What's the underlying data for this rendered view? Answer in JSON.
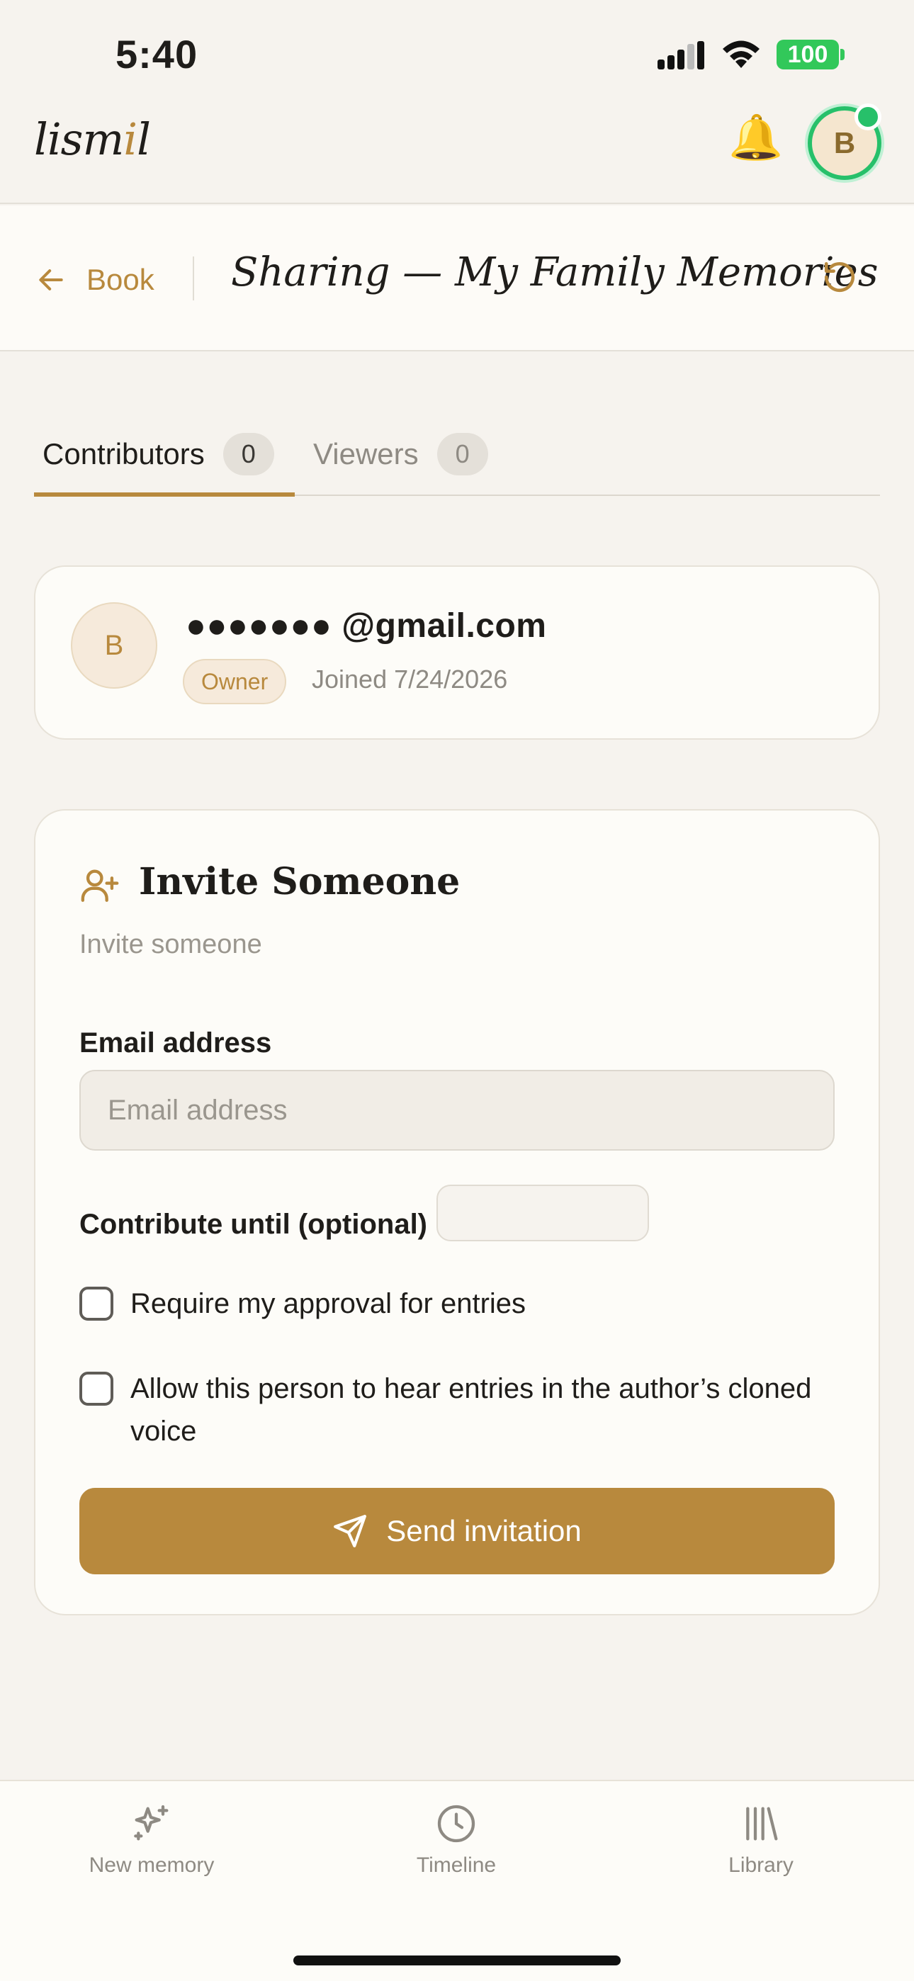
{
  "status_bar": {
    "time": "5:40",
    "battery": "100"
  },
  "header": {
    "logo_prefix": "lism",
    "logo_accent": "i",
    "logo_suffix": "l",
    "notification_icon": "bell-icon",
    "avatar_initial": "B"
  },
  "title_bar": {
    "back_label": "Book",
    "title": "Sharing — My Family Memories"
  },
  "tabs": [
    {
      "label": "Contributors",
      "count": "0",
      "active": true
    },
    {
      "label": "Viewers",
      "count": "0",
      "active": false
    }
  ],
  "owner": {
    "initial": "B",
    "email": "●●●●●●●  @gmail.com",
    "role": "Owner",
    "joined": "Joined 7/24/2026"
  },
  "invite": {
    "title": "Invite Someone",
    "subtitle": "Invite someone",
    "email_label": "Email address",
    "email_placeholder": "Email address",
    "email_value": "",
    "until_label": "Contribute until (optional)",
    "until_value": "",
    "approval_label": "Require my approval for entries",
    "approval_checked": false,
    "voice_label": "Allow this person to hear entries in the author’s cloned voice",
    "voice_checked": false,
    "send_label": "Send invitation"
  },
  "bottom_nav": [
    {
      "label": "New memory",
      "icon": "sparkles-icon"
    },
    {
      "label": "Timeline",
      "icon": "clock-icon"
    },
    {
      "label": "Library",
      "icon": "library-icon"
    }
  ],
  "colors": {
    "accent": "#b8893d",
    "background": "#f6f3ee",
    "card": "#fdfcf8",
    "online": "#27c06a"
  }
}
